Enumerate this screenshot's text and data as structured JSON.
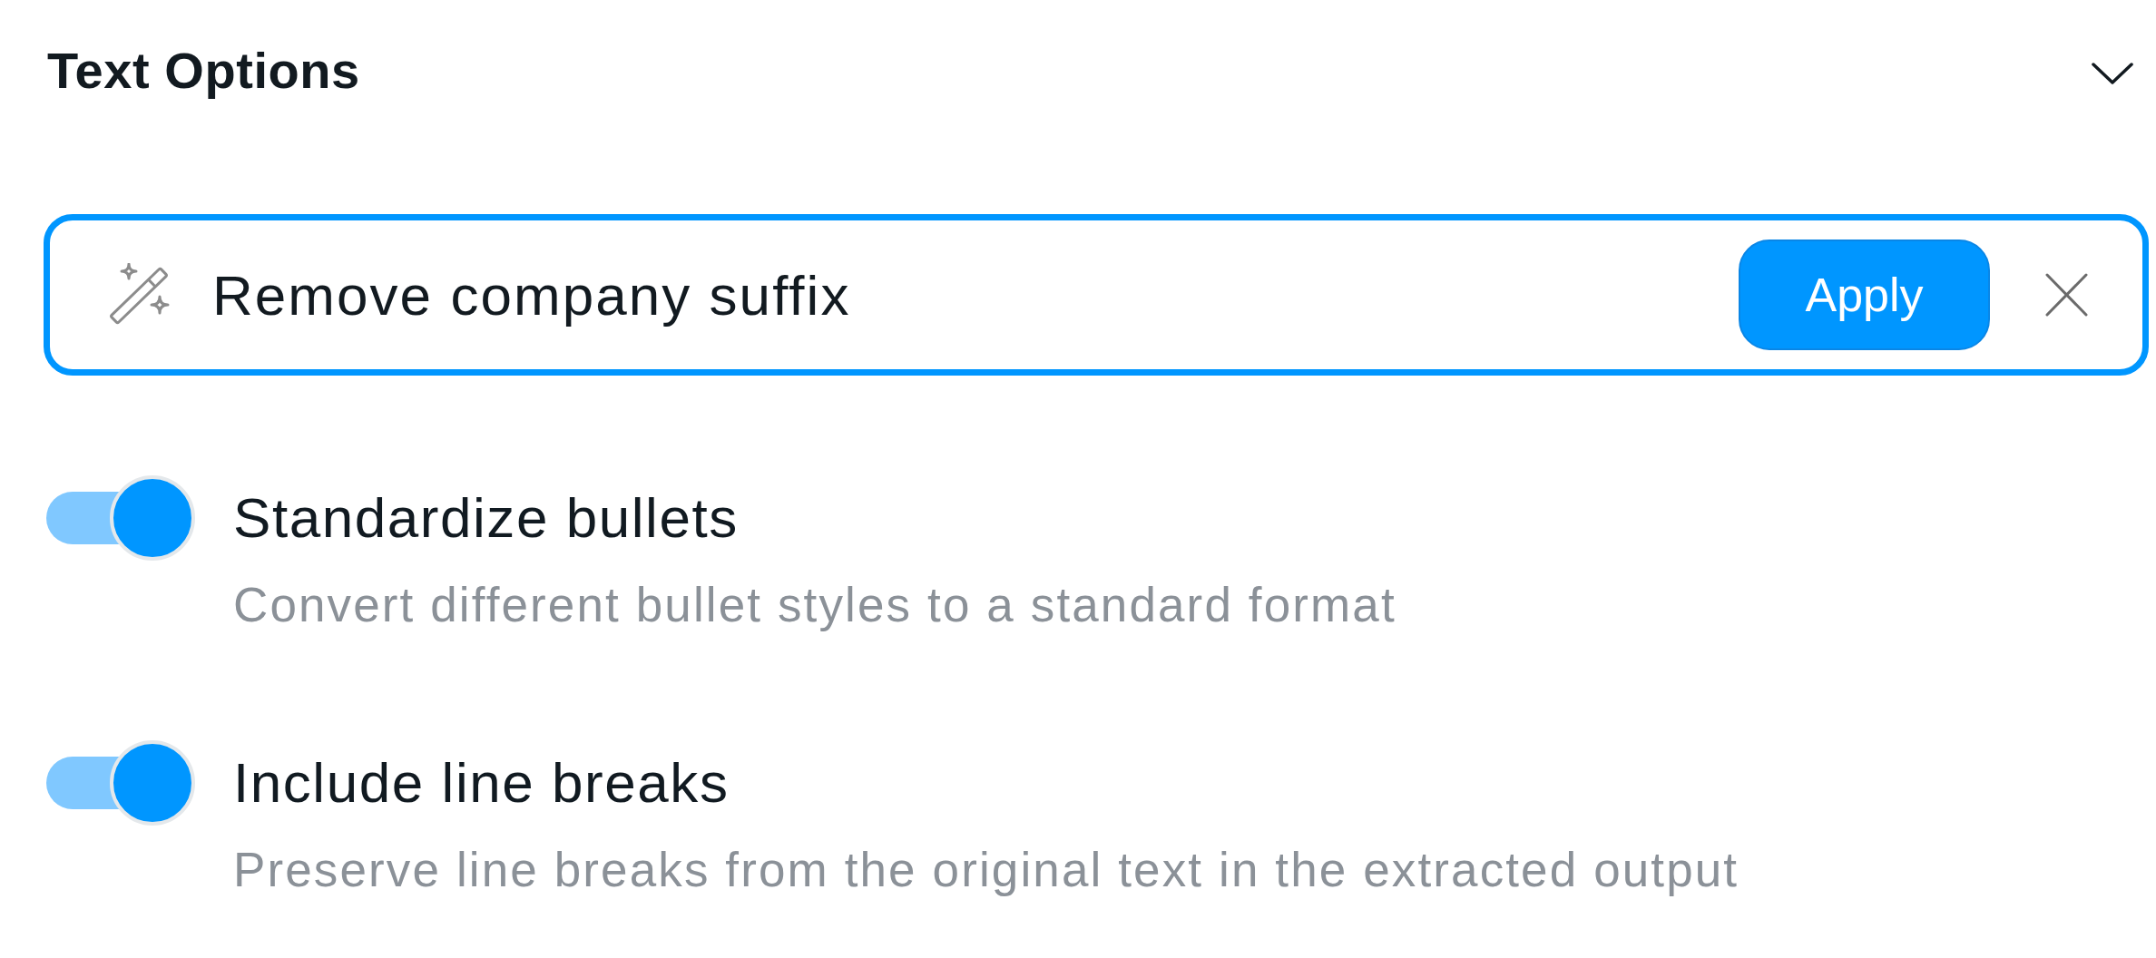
{
  "header": {
    "title": "Text Options",
    "expanded": true
  },
  "prompt": {
    "value": "Remove company suffix",
    "focused": true,
    "button": "Apply"
  },
  "options": [
    {
      "label": "Standardize bullets",
      "description": "Convert different bullet styles to a standard format",
      "on": true
    },
    {
      "label": "Include line breaks",
      "description": "Preserve line breaks from the original text in the extracted output",
      "on": true
    }
  ]
}
